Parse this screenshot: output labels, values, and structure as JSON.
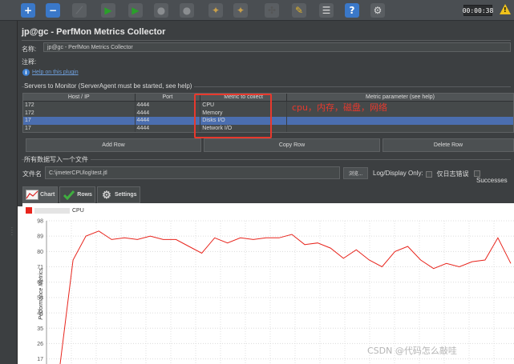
{
  "toolbar": {
    "timer": "00:00:38",
    "warning": "!",
    "buttons": [
      {
        "icon": "plus-icon",
        "glyph": "+",
        "color": "#3a78c9"
      },
      {
        "icon": "minus-icon",
        "glyph": "−",
        "color": "#3a78c9"
      },
      {
        "icon": "toggle-icon",
        "glyph": "⟋",
        "color": "#6a6e72"
      },
      {
        "icon": "play-icon",
        "glyph": "▶",
        "color": "#2aa02a"
      },
      {
        "icon": "play-no-pause-icon",
        "glyph": "▶",
        "color": "#2aa02a"
      },
      {
        "icon": "stop-icon",
        "glyph": "●",
        "color": "#8a8d90"
      },
      {
        "icon": "shutdown-icon",
        "glyph": "●",
        "color": "#8a8d90"
      },
      {
        "icon": "clear-icon",
        "glyph": "✦",
        "color": "#c9a04a"
      },
      {
        "icon": "clear-all-icon",
        "glyph": "✦",
        "color": "#c9a04a"
      },
      {
        "icon": "search-icon",
        "glyph": "✣",
        "color": "#555"
      },
      {
        "icon": "reset-search-icon",
        "glyph": "✎",
        "color": "#e3b52b"
      },
      {
        "icon": "function-helper-icon",
        "glyph": "☰",
        "color": "#dcdcdc"
      },
      {
        "icon": "help-icon",
        "glyph": "?",
        "color": "#3a78c9"
      },
      {
        "icon": "settings-icon",
        "glyph": "⚙",
        "color": "#dcdcdc"
      }
    ]
  },
  "panel": {
    "title": "jp@gc - PerfMon Metrics Collector",
    "name_label": "名称:",
    "name_value": "jp@gc - PerfMon Metrics Collector",
    "comment_label": "注释:",
    "help_link": "Help on this plugin",
    "servers_group": "Servers to Monitor (ServerAgent must be started, see help)",
    "columns": [
      "Host / IP",
      "Port",
      "Metric to collect",
      "Metric parameter (see help)"
    ],
    "rows": [
      {
        "host": "172",
        "port": "4444",
        "metric": "CPU",
        "param": "",
        "selected": false
      },
      {
        "host": "172",
        "port": "4444",
        "metric": "Memory",
        "param": "",
        "selected": false
      },
      {
        "host": "17",
        "port": "4444",
        "metric": "Disks I/O",
        "param": "",
        "selected": true
      },
      {
        "host": "17",
        "port": "4444",
        "metric": "Network I/O",
        "param": "",
        "selected": false
      }
    ],
    "annotation": "cpu，内存，磁盘，网络",
    "add_row": "Add Row",
    "copy_row": "Copy Row",
    "delete_row": "Delete Row",
    "file_group": "所有数据写入一个文件",
    "filename_label": "文件名",
    "filename_value": "C:\\jmeterCPUlog\\test.jtl",
    "browse": "浏览...",
    "log_display": "Log/Display Only:",
    "errors_only": "仅日志错误",
    "successes": "Successes"
  },
  "tabs": [
    {
      "label": "Chart",
      "icon": "chart-icon"
    },
    {
      "label": "Rows",
      "icon": "checkmark-icon"
    },
    {
      "label": "Settings",
      "icon": "gear-icon"
    }
  ],
  "chart_data": {
    "type": "line",
    "series": [
      {
        "name": "CPU",
        "color": "#e8241c",
        "values": [
          14,
          75,
          89,
          92,
          87,
          88,
          87,
          89,
          87,
          87,
          83,
          79,
          88,
          85,
          88,
          87,
          88,
          88,
          90,
          84,
          85,
          82,
          76,
          81,
          75,
          71,
          80,
          83,
          75,
          70,
          73,
          71,
          74,
          75,
          88,
          73
        ]
      }
    ],
    "yticks": [
      17,
      26,
      35,
      44,
      53,
      62,
      71,
      80,
      89,
      98
    ],
    "ylabel": "Performance Metrics",
    "ylim": [
      14,
      98
    ],
    "grid": true,
    "legend_position": "top-left"
  },
  "watermark": "CSDN @代码怎么敲哇"
}
